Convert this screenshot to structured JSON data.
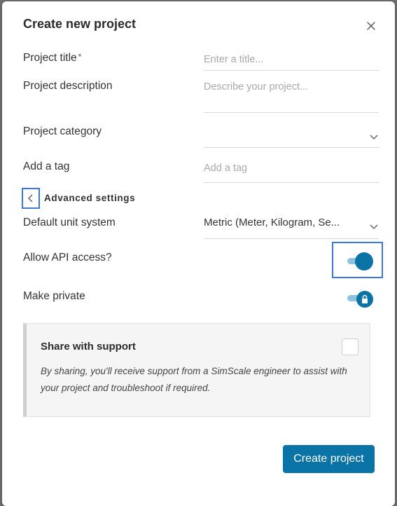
{
  "dialog": {
    "title": "Create new project",
    "close_icon": "close-icon"
  },
  "fields": {
    "title_label": "Project title",
    "required_mark": "*",
    "title_placeholder": "Enter a title...",
    "title_value": "",
    "description_label": "Project description",
    "description_placeholder": "Describe your project...",
    "description_value": "",
    "category_label": "Project category",
    "category_value": "",
    "tag_label": "Add a tag",
    "tag_placeholder": "Add a tag",
    "tag_value": ""
  },
  "advanced": {
    "label": "Advanced settings",
    "back_icon": "chevron-left-icon",
    "unit_label": "Default unit system",
    "unit_value": "Metric (Meter, Kilogram, Se...",
    "api_label": "Allow API access?",
    "api_enabled": true,
    "private_label": "Make private",
    "private_enabled": true,
    "private_icon": "lock-icon"
  },
  "share": {
    "title": "Share with support",
    "text": "By sharing, you'll receive support from a SimScale engineer to assist with your project and troubleshoot if required.",
    "checked": false
  },
  "footer": {
    "create_label": "Create project"
  },
  "colors": {
    "accent": "#0b74a6",
    "toggle_track": "#8fc3dc",
    "focus_outline": "#3b78d8"
  }
}
